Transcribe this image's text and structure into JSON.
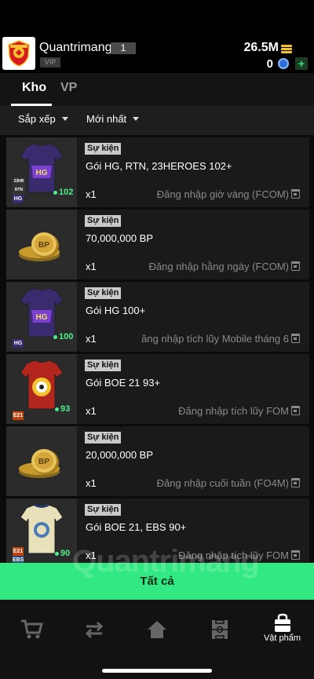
{
  "header": {
    "username": "Quantrimang",
    "level": "1",
    "vip": "VIP",
    "coins": "26.5M",
    "fc": "0",
    "add": "+"
  },
  "tabs": [
    {
      "label": "Kho",
      "active": true
    },
    {
      "label": "VP",
      "active": false
    }
  ],
  "filters": {
    "sort": "Sắp xếp",
    "newest": "Mới nhất"
  },
  "items": [
    {
      "tag": "Sự kiện",
      "title": "Gói HG, RTN, 23HEROES 102+",
      "qty": "x1",
      "source": "Đăng nhập giờ vàng (FCOM)",
      "ovr": "102",
      "badge": "HG"
    },
    {
      "tag": "Sự kiện",
      "title": "70,000,000 BP",
      "qty": "x1",
      "source": "Đăng nhập hằng ngày (FCOM)"
    },
    {
      "tag": "Sự kiện",
      "title": "Gói HG 100+",
      "qty": "x1",
      "source": "ăng nhập tích lũy Mobile tháng 6",
      "ovr": "100",
      "badge": "HG"
    },
    {
      "tag": "Sự kiện",
      "title": "Gói BOE 21 93+",
      "qty": "x1",
      "source": "Đăng nhập tích lũy FOM",
      "ovr": "93",
      "badge": "E21"
    },
    {
      "tag": "Sự kiện",
      "title": "20,000,000 BP",
      "qty": "x1",
      "source": "Đăng nhập cuối tuần (FO4M)"
    },
    {
      "tag": "Sự kiện",
      "title": "Gói BOE 21, EBS 90+",
      "qty": "x1",
      "source": "Đăng nhập tích lũy FOM",
      "ovr": "90",
      "badge": "EBS"
    }
  ],
  "coin_label": "BP",
  "all_button": "Tất cả",
  "bottom_nav": {
    "active_label": "Vật phẩm"
  },
  "watermark": "Quantrimang",
  "colors": {
    "accent_green": "#32e882",
    "tag_bg": "#c9c9c9",
    "item_bg": "#1a1a1a",
    "vip_purple": "#3a2a6e",
    "boe_red": "#b3261e",
    "ebs_cream": "#e8e0b8"
  }
}
